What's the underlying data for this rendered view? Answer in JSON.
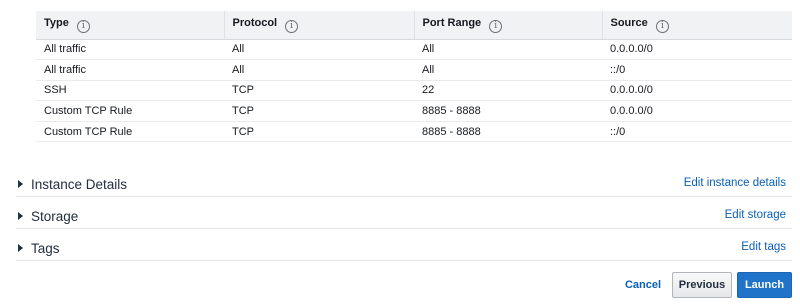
{
  "table": {
    "headers": [
      "Type",
      "Protocol",
      "Port Range",
      "Source"
    ],
    "info_glyph": "i",
    "rows": [
      [
        "All traffic",
        "All",
        "All",
        "0.0.0.0/0"
      ],
      [
        "All traffic",
        "All",
        "All",
        "::/0"
      ],
      [
        "SSH",
        "TCP",
        "22",
        "0.0.0.0/0"
      ],
      [
        "Custom TCP Rule",
        "TCP",
        "8885 - 8888",
        "0.0.0.0/0"
      ],
      [
        "Custom TCP Rule",
        "TCP",
        "8885 - 8888",
        "::/0"
      ]
    ]
  },
  "sections": [
    {
      "title": "Instance Details",
      "edit_label": "Edit instance details"
    },
    {
      "title": "Storage",
      "edit_label": "Edit storage"
    },
    {
      "title": "Tags",
      "edit_label": "Edit tags"
    }
  ],
  "footer": {
    "cancel_label": "Cancel",
    "previous_label": "Previous",
    "launch_label": "Launch"
  },
  "colors": {
    "link": "#0a5fb4",
    "primary_button": "#1f73c9",
    "header_bg": "#f1f2f4"
  },
  "icons": [
    "info-icon",
    "caret-right-icon"
  ]
}
